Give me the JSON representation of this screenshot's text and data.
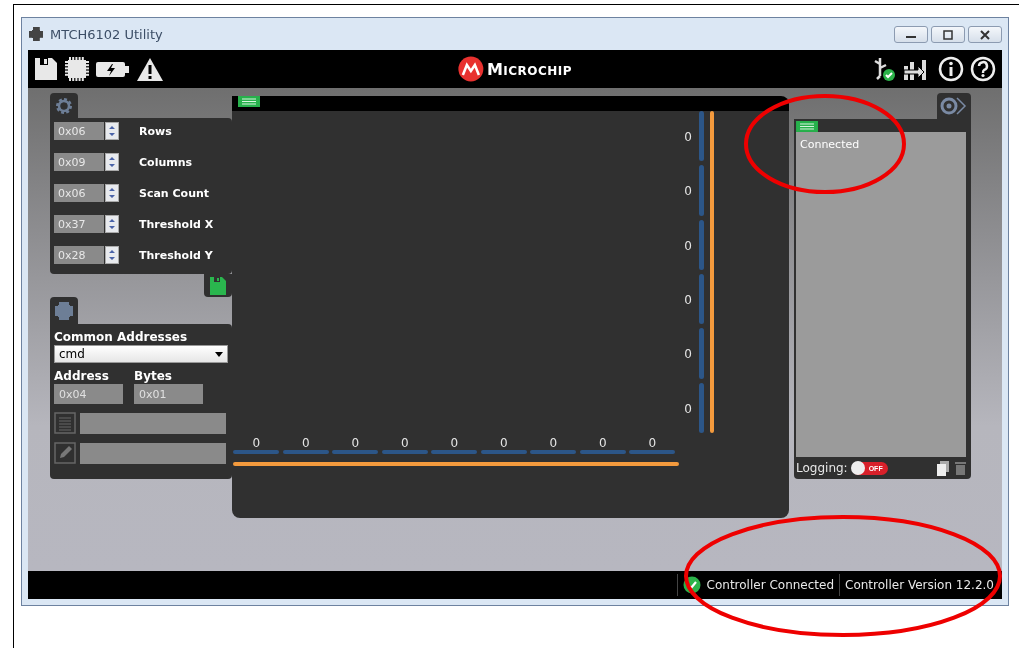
{
  "window": {
    "title": "MTCH6102 Utility"
  },
  "logo": {
    "text": "MICROCHIP"
  },
  "settings": [
    {
      "value": "0x06",
      "label": "Rows"
    },
    {
      "value": "0x09",
      "label": "Columns"
    },
    {
      "value": "0x06",
      "label": "Scan Count"
    },
    {
      "value": "0x37",
      "label": "Threshold X"
    },
    {
      "value": "0x28",
      "label": "Threshold Y"
    }
  ],
  "address_panel": {
    "common_label": "Common Addresses",
    "common_value": "cmd",
    "address_label": "Address",
    "address_value": "0x04",
    "bytes_label": "Bytes",
    "bytes_value": "0x01"
  },
  "sensor": {
    "row_readings": [
      "0",
      "0",
      "0",
      "0",
      "0",
      "0"
    ],
    "column_readings": [
      "0",
      "0",
      "0",
      "0",
      "0",
      "0",
      "0",
      "0",
      "0"
    ]
  },
  "log": {
    "lines": [
      "Connected"
    ],
    "logging_label": "Logging:",
    "logging_on": false,
    "toggle_text": "OFF"
  },
  "status_bar": {
    "items": [
      "Controller Connected",
      "Controller Version 12.2.0"
    ]
  }
}
